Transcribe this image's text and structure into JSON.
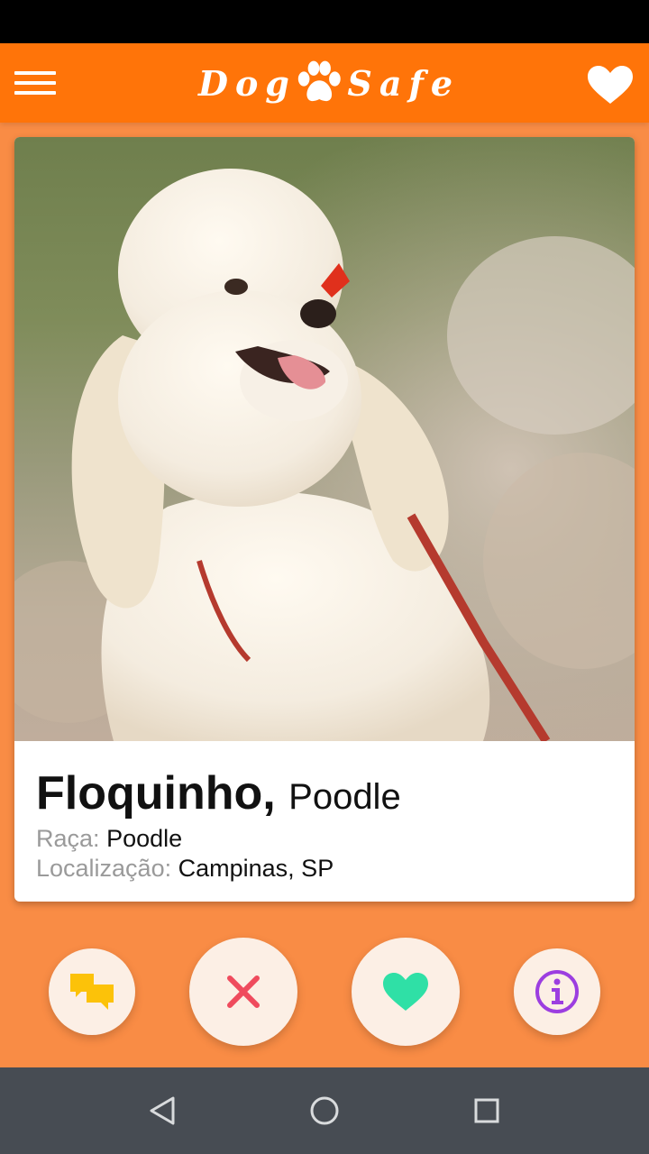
{
  "app": {
    "title_left": "Dog",
    "title_right": "Safe",
    "brand_color": "#ff7409",
    "background_color": "#f98c45"
  },
  "header": {
    "menu_icon": "hamburger-menu-icon",
    "logo_icon": "paw-icon",
    "favorites_icon": "heart-icon"
  },
  "profile": {
    "name": "Floquinho,",
    "breed_inline": "Poodle",
    "breed_label": "Raça:",
    "breed_value": "Poodle",
    "location_label": "Localização:",
    "location_value": "Campinas, SP"
  },
  "actions": [
    {
      "icon": "chat-icon",
      "color": "#fcc209"
    },
    {
      "icon": "close-icon",
      "color": "#ef4b5d"
    },
    {
      "icon": "heart-icon",
      "color": "#2fe0a6"
    },
    {
      "icon": "info-icon",
      "color": "#9c3ee0"
    }
  ],
  "system_nav": {
    "back_icon": "back-triangle-icon",
    "home_icon": "home-circle-icon",
    "recents_icon": "recents-square-icon"
  }
}
